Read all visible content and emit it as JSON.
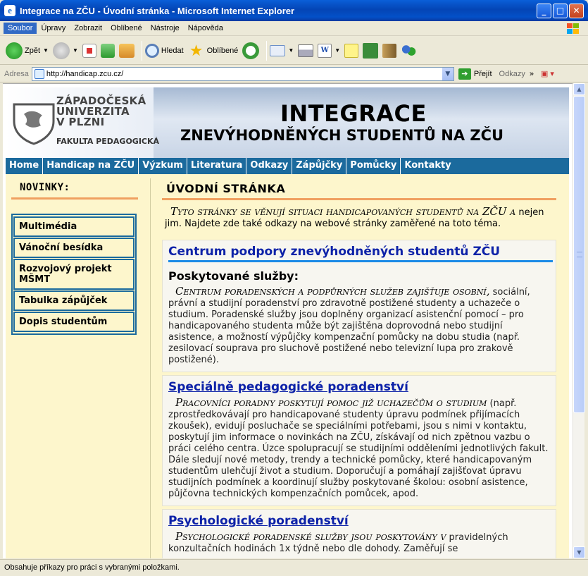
{
  "window": {
    "title": "Integrace na ZČU - Úvodní stránka - Microsoft Internet Explorer"
  },
  "menu": [
    "Soubor",
    "Úpravy",
    "Zobrazit",
    "Oblíbené",
    "Nástroje",
    "Nápověda"
  ],
  "toolbar": {
    "back": "Zpět",
    "search": "Hledat",
    "favorites": "Oblíbené"
  },
  "address": {
    "label": "Adresa",
    "url": "http://handicap.zcu.cz/",
    "go": "Přejít",
    "links": "Odkazy"
  },
  "banner": {
    "uni_line1": "ZÁPADOČESKÁ",
    "uni_line2": "UNIVERZITA",
    "uni_line3": "V PLZNI",
    "faculty": "FAKULTA PEDAGOGICKÁ",
    "title1": "INTEGRACE",
    "title2": "ZNEVÝHODNĚNÝCH STUDENTŮ NA ZČU"
  },
  "nav": [
    "Home",
    "Handicap na ZČU",
    "Výzkum",
    "Literatura",
    "Odkazy",
    "Zápůjčky",
    "Pomůcky",
    "Kontakty"
  ],
  "sidebar": {
    "heading": "NOVINKY:",
    "items": [
      "Multimédia",
      "Vánoční besídka",
      "Rozvojový projekt MŠMT",
      "Tabulka zápůjček",
      "Dopis studentům"
    ]
  },
  "main": {
    "heading": "ÚVODNÍ STRÁNKA",
    "intro_lead": "Tyto stránky se věnují situaci handicapovaných studentů na ZČU a",
    "intro_rest": "nejen jim. Najdete zde také odkazy na webové stránky zaměřené na toto téma.",
    "sections": [
      {
        "title": "Centrum podpory znevýhodněných studentů ZČU",
        "subheading": "Poskytované služby:",
        "lead": "Centrum poradenských a podpůrných služeb zajišťuje osobní,",
        "body": "sociální, právní a studijní poradenství pro zdravotně postižené studenty a uchazeče o studium. Poradenské služby jsou doplněny organizací asistenční pomocí – pro handicapovaného studenta může být zajištěna doprovodná nebo studijní asistence, a možností výpůjčky kompenzační pomůcky na dobu studia (např. zesilovací souprava pro sluchově postižené nebo televizní lupa pro zrakově postižené)."
      },
      {
        "title": "Speciálně pedagogické poradenství",
        "lead": "Pracovníci poradny poskytují pomoc již uchazečům o studium",
        "body": "(např. zprostředkovávají pro handicapované studenty úpravu podmínek přijímacích zkoušek), evidují posluchače se speciálními potřebami, jsou s nimi v kontaktu, poskytují jim informace o novinkách na ZČU, získávají od nich zpětnou vazbu o práci celého centra. Úzce spolupracují se studijními odděleními jednotlivých fakult. Dále sledují nové metody, trendy a technické pomůcky, které handicapovaným studentům ulehčují život a studium. Doporučují a pomáhají zajišťovat úpravu studijních podmínek a koordinují služby poskytované školou: osobní asistence, půjčovna technických kompenzačních pomůcek, apod."
      },
      {
        "title": "Psychologické poradenství",
        "lead": "Psychologické poradenské služby jsou poskytovány v",
        "body": "pravidelných konzultačních hodinách 1x týdně nebo dle dohody. Zaměřují se"
      }
    ]
  },
  "status": "Obsahuje příkazy pro práci s vybranými položkami.",
  "colors": {
    "nav": "#1b6a9d",
    "page_bg": "#fdf6cc",
    "accent_rule": "#f0a060",
    "link": "#0d22a8"
  }
}
